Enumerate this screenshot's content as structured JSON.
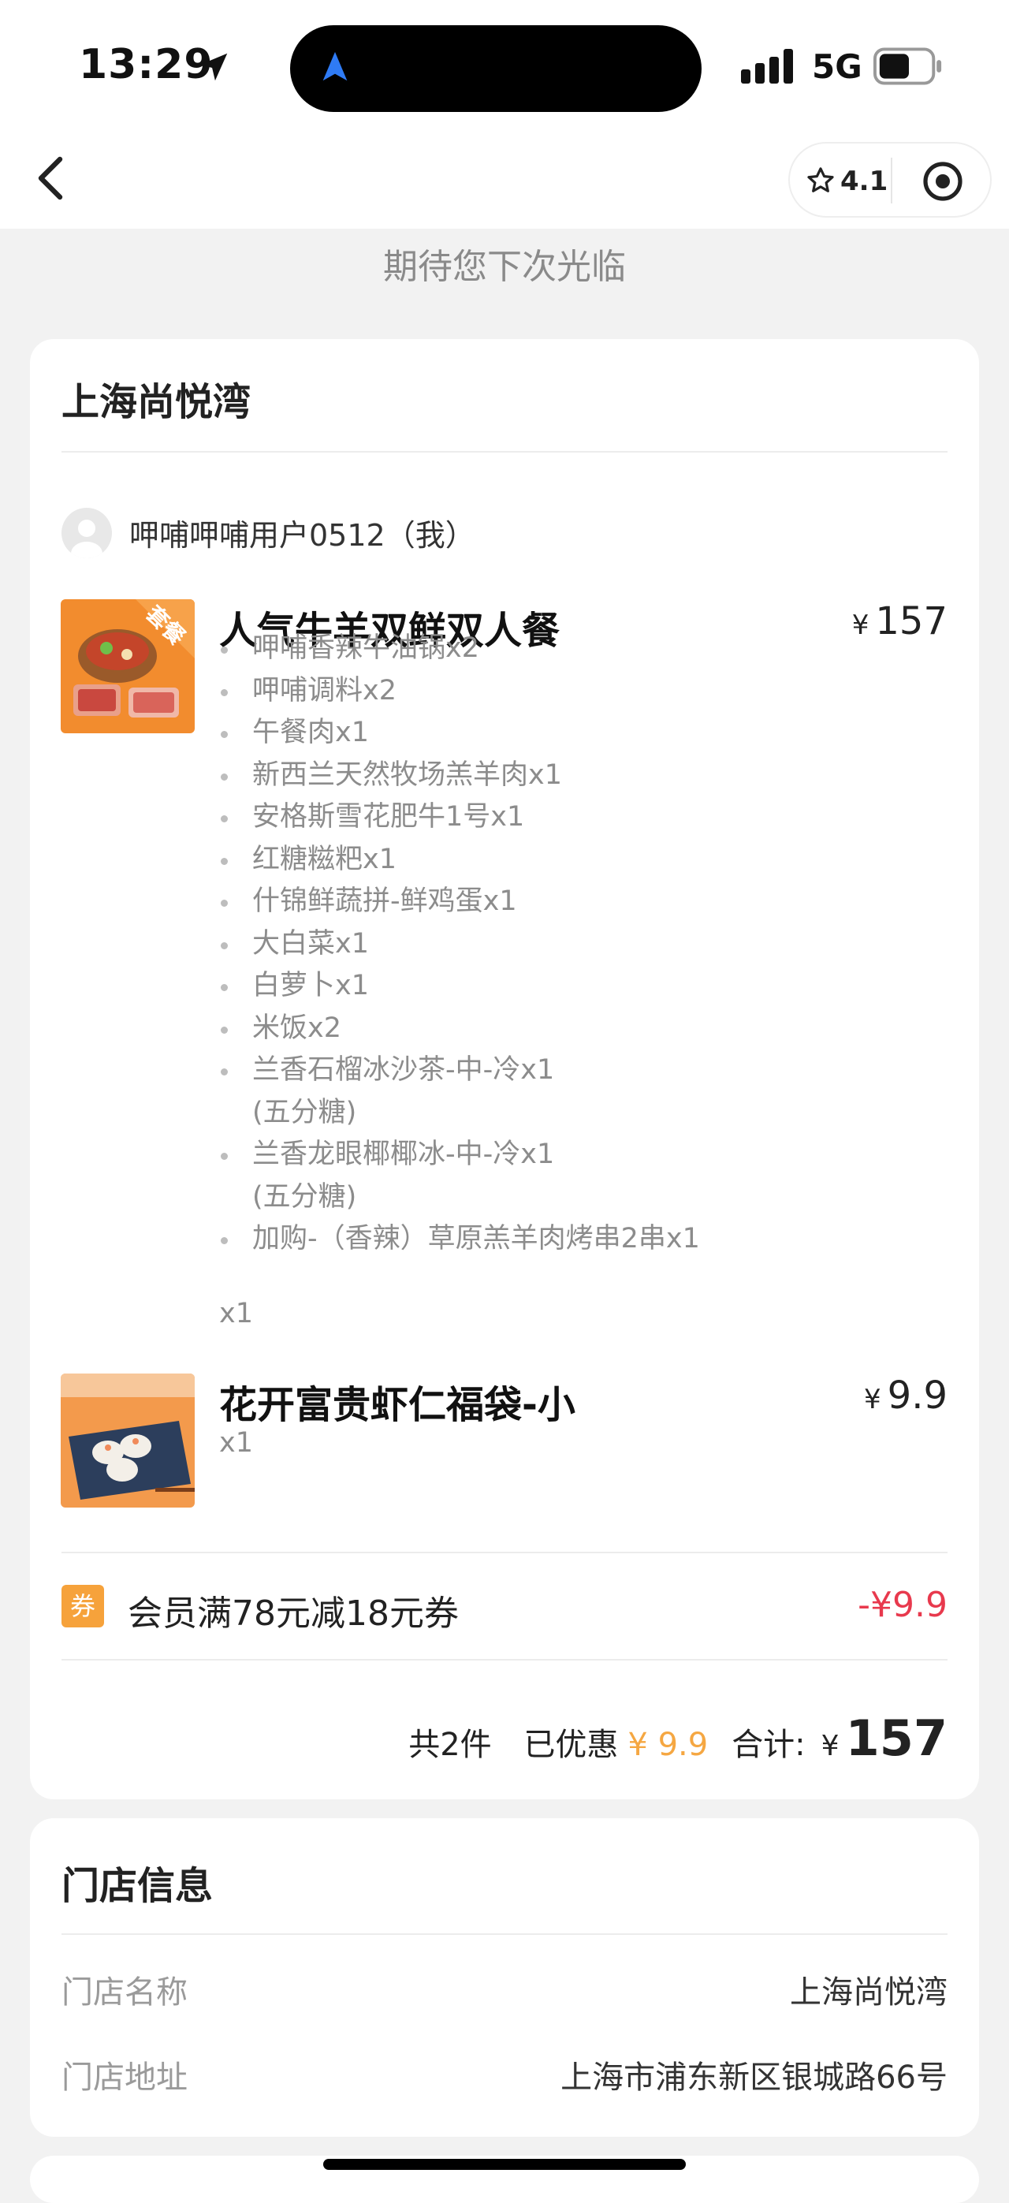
{
  "status_bar": {
    "time": "13:29",
    "network": "5G"
  },
  "nav": {
    "rating": "4.1"
  },
  "farewell": "期待您下次光临",
  "order": {
    "store_title": "上海尚悦湾",
    "user": "呷哺呷哺用户0512（我）",
    "items": [
      {
        "name": "人气牛羊双鲜双人餐",
        "currency": "¥",
        "price": "157",
        "badge": "套餐",
        "quantity": "x1",
        "subitems": [
          {
            "text": "呷哺香辣牛油锅x2"
          },
          {
            "text": "呷哺调料x2"
          },
          {
            "text": "午餐肉x1"
          },
          {
            "text": "新西兰天然牧场羔羊肉x1"
          },
          {
            "text": "安格斯雪花肥牛1号x1"
          },
          {
            "text": "红糖糍粑x1"
          },
          {
            "text": "什锦鲜蔬拼-鲜鸡蛋x1"
          },
          {
            "text": "大白菜x1"
          },
          {
            "text": "白萝卜x1"
          },
          {
            "text": "米饭x2"
          },
          {
            "text": "兰香石榴冰沙茶-中-冷x1",
            "note": "(五分糖)"
          },
          {
            "text": "兰香龙眼椰椰冰-中-冷x1",
            "note": "(五分糖)"
          },
          {
            "text": "加购-（香辣）草原羔羊肉烤串2串x1"
          }
        ]
      },
      {
        "name": "花开富贵虾仁福袋-小",
        "currency": "¥",
        "price": "9.9",
        "quantity": "x1"
      }
    ],
    "coupon": {
      "tag": "券",
      "label": "会员满78元减18元券",
      "amount": "-¥9.9"
    },
    "summary": {
      "count_text": "共2件",
      "discount_label": "已优惠",
      "discount_value": "¥ 9.9",
      "total_label": "合计:",
      "currency": "¥",
      "total": "157"
    }
  },
  "store_info": {
    "title": "门店信息",
    "rows": [
      {
        "label": "门店名称",
        "value": "上海尚悦湾"
      },
      {
        "label": "门店地址",
        "value": "上海市浦东新区银城路66号"
      }
    ]
  },
  "colors": {
    "accent_orange": "#f5a742",
    "discount_red": "#e8394d",
    "background": "#f2f2f2"
  }
}
